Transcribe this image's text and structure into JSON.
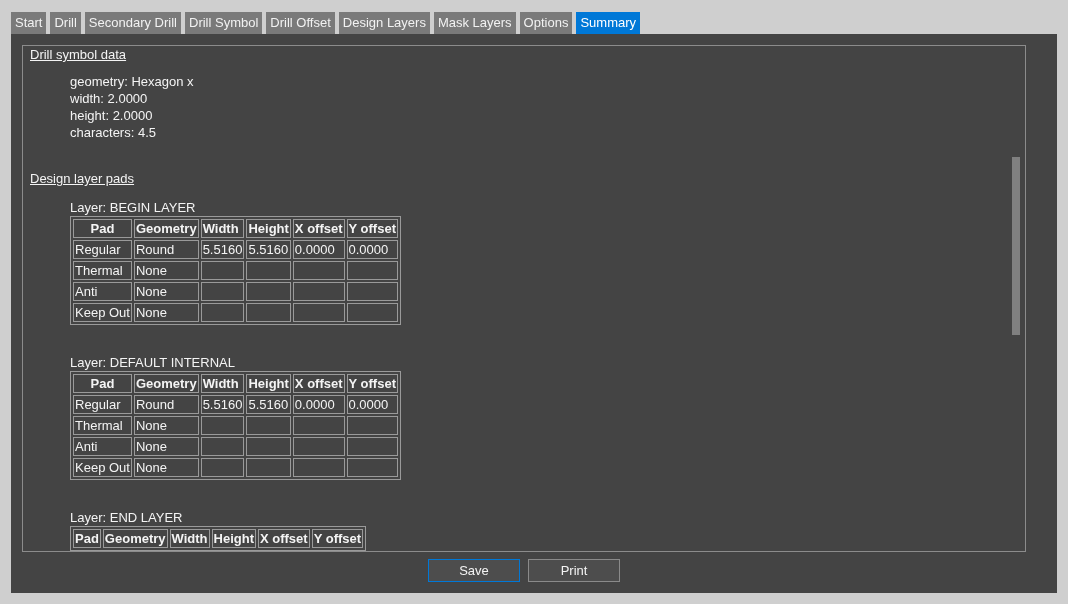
{
  "tabs": [
    {
      "label": "Start",
      "selected": false
    },
    {
      "label": "Drill",
      "selected": false
    },
    {
      "label": "Secondary Drill",
      "selected": false
    },
    {
      "label": "Drill Symbol",
      "selected": false
    },
    {
      "label": "Drill Offset",
      "selected": false
    },
    {
      "label": "Design Layers",
      "selected": false
    },
    {
      "label": "Mask Layers",
      "selected": false
    },
    {
      "label": "Options",
      "selected": false
    },
    {
      "label": "Summary",
      "selected": true
    }
  ],
  "summary": {
    "sections": [
      {
        "kind": "properties",
        "heading": "Drill symbol data",
        "lines": [
          "geometry: Hexagon x",
          "width: 2.0000",
          "height: 2.0000",
          "characters: 4.5"
        ]
      },
      {
        "kind": "layer_pads",
        "heading": "Design layer pads",
        "layers": [
          {
            "label": "Layer: BEGIN LAYER",
            "columns": [
              "Pad",
              "Geometry",
              "Width",
              "Height",
              "X offset",
              "Y offset"
            ],
            "rows": [
              [
                "Regular",
                "Round",
                "5.5160",
                "5.5160",
                "0.0000",
                "0.0000"
              ],
              [
                "Thermal",
                "None"
              ],
              [
                "Anti",
                "None"
              ],
              [
                "Keep Out",
                "None"
              ]
            ]
          },
          {
            "label": "Layer: DEFAULT INTERNAL",
            "columns": [
              "Pad",
              "Geometry",
              "Width",
              "Height",
              "X offset",
              "Y offset"
            ],
            "rows": [
              [
                "Regular",
                "Round",
                "5.5160",
                "5.5160",
                "0.0000",
                "0.0000"
              ],
              [
                "Thermal",
                "None"
              ],
              [
                "Anti",
                "None"
              ],
              [
                "Keep Out",
                "None"
              ]
            ]
          },
          {
            "label": "Layer: END LAYER",
            "columns": [
              "Pad",
              "Geometry",
              "Width",
              "Height",
              "X offset",
              "Y offset"
            ]
          }
        ]
      }
    ]
  },
  "buttons": [
    {
      "label": "Save",
      "focused": true
    },
    {
      "label": "Print",
      "focused": false
    }
  ]
}
